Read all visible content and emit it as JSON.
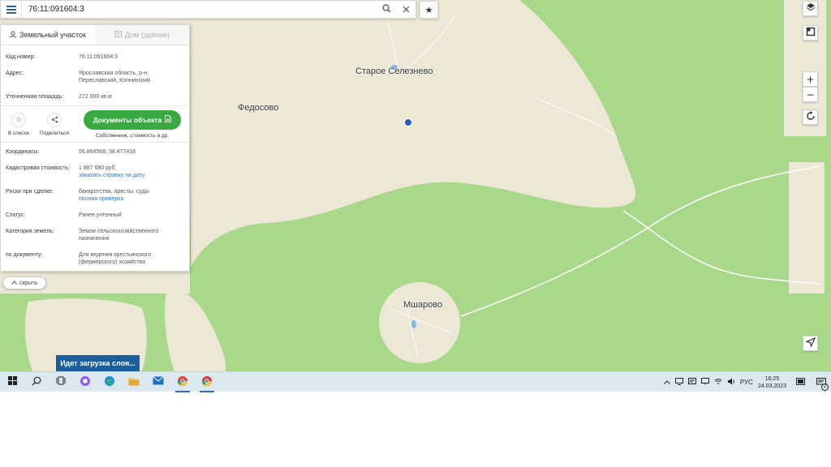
{
  "search": {
    "value": "76:11:091604:3",
    "menu_icon": "hamburger-icon",
    "search_icon": "search-icon",
    "clear_icon": "close-icon",
    "favorite_icon": "star-icon"
  },
  "map": {
    "labels": {
      "staroe": "Старое Селезнево",
      "fedosovo": "Федосово",
      "msharovo": "Мшарово"
    },
    "colors": {
      "forest": "#a9d88a",
      "field": "#ede7d5",
      "road": "#ffffff",
      "point": "#1f5fae"
    },
    "controls": {
      "layers": "layers-icon",
      "fullscreen": "fullscreen-icon",
      "zoom_in": "+",
      "zoom_out": "−",
      "rotate": "rotate-icon",
      "locate": "locate-arrow-icon"
    }
  },
  "panel": {
    "tab_land": "Земельный участок",
    "tab_house": "Дом (здание)",
    "cad_label": "Кад.номер:",
    "cad_value": "76:11:091604:3",
    "address_label": "Адрес:",
    "address_value": "Ярославская область, р-н. Переславский, Копнинский",
    "area_label": "Уточненная площадь:",
    "area_value": "272 000 кв.м",
    "add_to_list": "В список",
    "share": "Поделиться",
    "docs_button": "Документы объекта",
    "docs_sub": "Собственник, стоимость и др.",
    "coords_label": "Координаты:",
    "coords_value": "56.864568, 38.477418",
    "cost_label": "Кадастровая стоимость:",
    "cost_value": "1 887 680 руб.",
    "cost_link": "заказать справку на дату",
    "risk_label": "Риски при сделке:",
    "risk_value": "банкротства, аресты, суды",
    "risk_link": "полная проверка",
    "status_label": "Статус:",
    "status_value": "Ранее учтенный",
    "category_label": "Категория земель:",
    "category_value": "Земли сельскохозяйственного назначения",
    "doc_label": "по документу:",
    "doc_value": "Для ведения крестьянского (фермерского) хозяйства",
    "hide": "скрыть"
  },
  "loading": "Идет загрузка слоя...",
  "taskbar": {
    "lang": "РУС",
    "time": "16:25",
    "date": "24.03.2023",
    "notifications": "2"
  }
}
